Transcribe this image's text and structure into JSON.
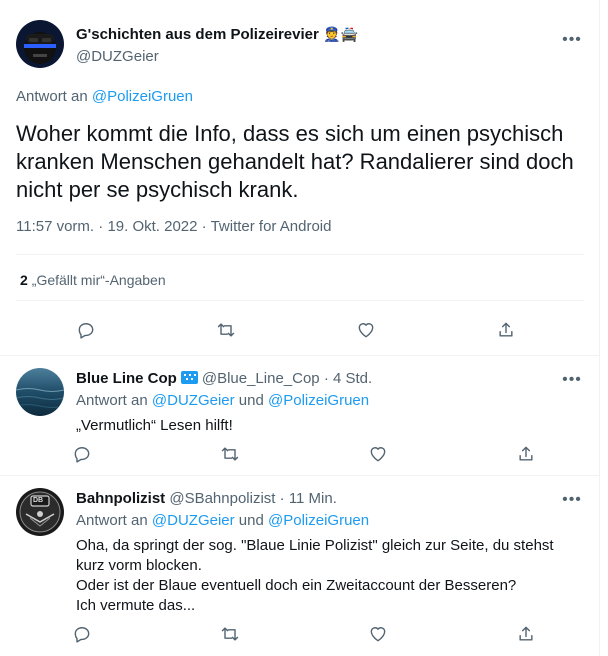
{
  "main_tweet": {
    "display_name": "G'schichten aus dem Polizeirevier",
    "name_emoji": "👮🚔",
    "handle": "@DUZGeier",
    "reply_prefix": "Antwort an",
    "reply_to": "@PolizeiGruen",
    "text": "Woher kommt die Info,  dass es sich um einen psychisch kranken Menschen gehandelt hat? Randalierer sind doch nicht per se psychisch krank.",
    "time": "11:57 vorm.",
    "date": "19. Okt. 2022",
    "client": "Twitter for Android",
    "dot": "·",
    "like_count": "2",
    "like_label": "„Gefällt mir“-Angaben",
    "more": "•••"
  },
  "replies": [
    {
      "display_name": "Blue Line Cop",
      "handle": "@Blue_Line_Cop",
      "age": "4 Std.",
      "reply_prefix": "Antwort an",
      "reply_to_1": "@DUZGeier",
      "reply_and": "und",
      "reply_to_2": "@PolizeiGruen",
      "text": "„Vermutlich“ Lesen hilft!",
      "more": "•••"
    },
    {
      "display_name": "Bahnpolizist",
      "handle": "@SBahnpolizist",
      "age": "11 Min.",
      "reply_prefix": "Antwort an",
      "reply_to_1": "@DUZGeier",
      "reply_and": "und",
      "reply_to_2": "@PolizeiGruen",
      "text_line1": "Oha, da springt der sog. \"Blaue Linie Polizist\" gleich zur Seite, du stehst kurz vorm blocken.",
      "text_line2": "Oder ist der Blaue eventuell doch ein Zweitaccount der Besseren?",
      "text_line3": "Ich vermute das...",
      "avatar_text": "DB",
      "more": "•••"
    }
  ],
  "colors": {
    "link": "#1d9bf0",
    "secondary_text": "#536471",
    "primary_text": "#0f1419",
    "divider": "#eff3f4"
  },
  "icons": [
    "reply-icon",
    "retweet-icon",
    "like-icon",
    "share-icon",
    "more-icon"
  ]
}
